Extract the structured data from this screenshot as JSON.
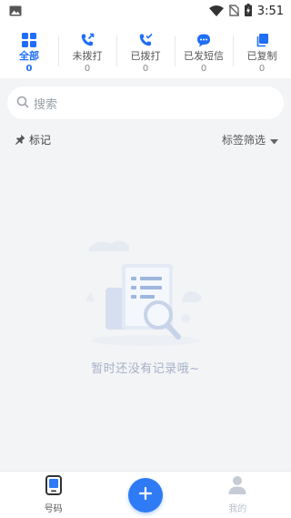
{
  "status_bar": {
    "time": "3:51",
    "icons": [
      "image-icon",
      "wifi-icon",
      "no-sim-icon",
      "battery-charging-icon"
    ]
  },
  "tabs": [
    {
      "label": "全部",
      "count": "0",
      "icon": "grid-icon",
      "active": true
    },
    {
      "label": "未拨打",
      "count": "0",
      "icon": "missed-call-icon",
      "active": false
    },
    {
      "label": "已拨打",
      "count": "0",
      "icon": "called-icon",
      "active": false
    },
    {
      "label": "已发短信",
      "count": "0",
      "icon": "sms-icon",
      "active": false
    },
    {
      "label": "已复制",
      "count": "0",
      "icon": "copy-icon",
      "active": false
    }
  ],
  "search": {
    "placeholder": "搜索"
  },
  "tag_bar": {
    "label": "标记",
    "filter_label": "标签筛选"
  },
  "empty_state": {
    "message": "暂时还没有记录哦~"
  },
  "bottom_nav": {
    "left_label": "号码",
    "right_label": "我的",
    "add_icon": "plus-icon"
  },
  "colors": {
    "accent": "#1f6ef5",
    "fab": "#2f7bf5",
    "background": "#f3f4f6",
    "empty_text": "#a6b1c7"
  }
}
